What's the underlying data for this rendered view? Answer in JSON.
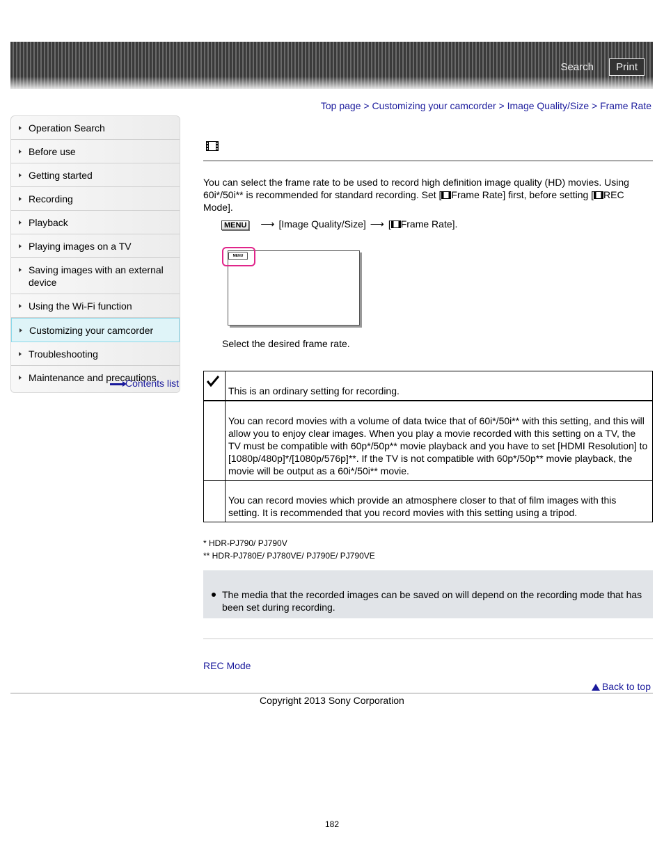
{
  "header": {
    "search_label": "Search",
    "print_label": "Print"
  },
  "breadcrumb": {
    "items": [
      "Top page",
      "Customizing your camcorder",
      "Image Quality/Size",
      "Frame Rate"
    ],
    "separator": ">"
  },
  "sidebar": {
    "items": [
      {
        "label": "Operation Search",
        "active": false
      },
      {
        "label": "Before use",
        "active": false
      },
      {
        "label": "Getting started",
        "active": false
      },
      {
        "label": "Recording",
        "active": false
      },
      {
        "label": "Playback",
        "active": false
      },
      {
        "label": "Playing images on a TV",
        "active": false
      },
      {
        "label": "Saving images with an external device",
        "active": false
      },
      {
        "label": "Using the Wi-Fi function",
        "active": false
      },
      {
        "label": "Customizing your camcorder",
        "active": true
      },
      {
        "label": "Troubleshooting",
        "active": false
      },
      {
        "label": "Maintenance and precautions",
        "active": false
      }
    ],
    "contents_list_label": "Contents list"
  },
  "main": {
    "title_icon": "movie-film-icon",
    "intro_part1": "You can select the frame rate to be used to record high definition image quality (HD) movies. Using 60i*/50i** is recommended for standard recording. Set [",
    "intro_part2": "Frame Rate] first, before setting [",
    "intro_part3": "REC Mode].",
    "step": {
      "menu_label": "MENU",
      "arrow": "⟶",
      "item1": "[Image Quality/Size]",
      "item2_pre": "[",
      "item2_post": "Frame Rate]."
    },
    "screen_menu_label": "MENU",
    "select_text": "Select the desired frame rate.",
    "options": [
      {
        "checked": true,
        "description": "This is an ordinary setting for recording."
      },
      {
        "checked": false,
        "description": "You can record movies with a volume of data twice that of 60i*/50i** with this setting, and this will allow you to enjoy clear images. When you play a movie recorded with this setting on a TV, the TV must be compatible with 60p*/50p** movie playback and you have to set [HDMI Resolution] to [1080p/480p]*/[1080p/576p]**. If the TV is not compatible with 60p*/50p** movie playback, the movie will be output as a 60i*/50i** movie."
      },
      {
        "checked": false,
        "description": "You can record movies which provide an atmosphere closer to that of film images with this setting. It is recommended that you record movies with this setting using a tripod."
      }
    ],
    "footnotes": [
      "* HDR-PJ790/ PJ790V",
      "** HDR-PJ780E/ PJ780VE/ PJ790E/ PJ790VE"
    ],
    "note": "The media that the recorded images can be saved on will depend on the recording mode that has been set during recording.",
    "related_link": "REC Mode"
  },
  "footer": {
    "back_to_top": "Back to top",
    "copyright": "Copyright 2013 Sony Corporation",
    "page_number": "182"
  },
  "colors": {
    "link": "#1a1a9c",
    "active_nav_bg": "#dff4f8",
    "highlight": "#e0258a",
    "note_bg": "#e1e4e8"
  }
}
